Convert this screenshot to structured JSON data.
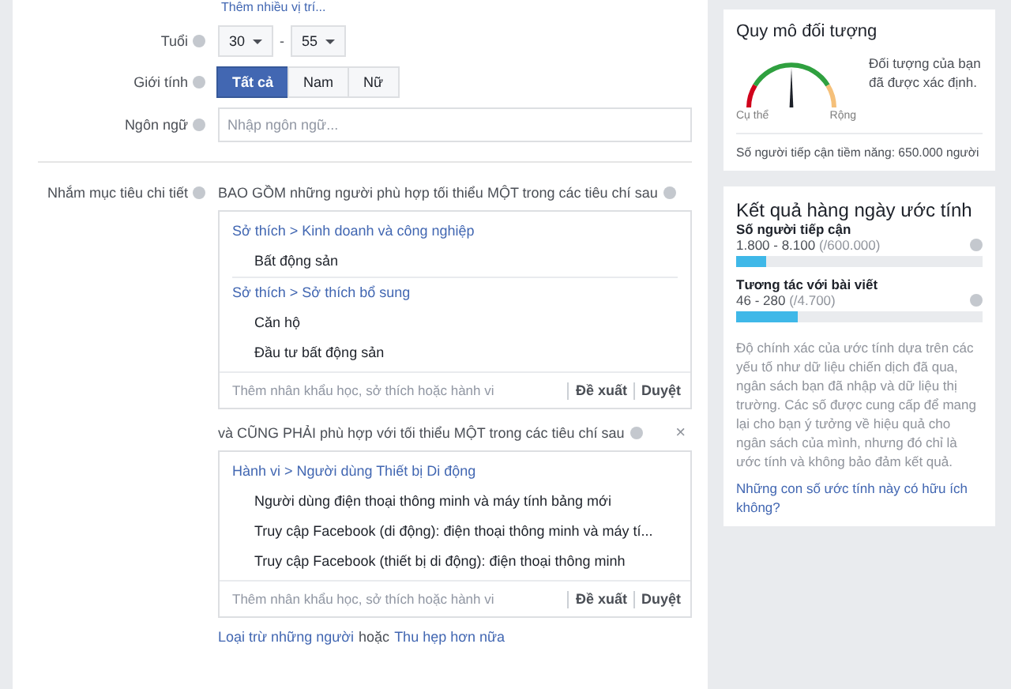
{
  "more_locations_link": "Thêm nhiều vị trí...",
  "age": {
    "label": "Tuổi",
    "from": "30",
    "separator": "-",
    "to": "55"
  },
  "gender": {
    "label": "Giới tính",
    "options": [
      {
        "label": "Tất cả",
        "selected": true
      },
      {
        "label": "Nam",
        "selected": false
      },
      {
        "label": "Nữ",
        "selected": false
      }
    ]
  },
  "language": {
    "label": "Ngôn ngữ",
    "placeholder": "Nhập ngôn ngữ..."
  },
  "detailed_targeting": {
    "label": "Nhắm mục tiêu chi tiết",
    "groups": [
      {
        "heading": "BAO GỒM những người phù hợp tối thiểu MỘT trong các tiêu chí sau",
        "categories": [
          {
            "path": "Sở thích > Kinh doanh và công nghiệp",
            "items": [
              "Bất động sản"
            ]
          },
          {
            "path": "Sở thích > Sở thích bổ sung",
            "items": [
              "Căn hộ",
              "Đầu tư bất động sản"
            ]
          }
        ],
        "placeholder": "Thêm nhân khẩu học, sở thích hoặc hành vi",
        "suggest": "Đề xuất",
        "browse": "Duyệt"
      },
      {
        "heading": "và CŨNG PHẢI phù hợp với tối thiểu MỘT trong các tiêu chí sau",
        "close": "×",
        "categories": [
          {
            "path": "Hành vi > Người dùng Thiết bị Di động",
            "items": [
              "Người dùng điện thoại thông minh và máy tính bảng mới",
              "Truy cập Facebook (di động): điện thoại thông minh và máy tí...",
              "Truy cập Facebook (thiết bị di động): điện thoại thông minh"
            ]
          }
        ],
        "placeholder": "Thêm nhân khẩu học, sở thích hoặc hành vi",
        "suggest": "Đề xuất",
        "browse": "Duyệt"
      }
    ]
  },
  "exclude_link": "Loại trừ những người",
  "or_text": "hoặc",
  "narrow_link": "Thu hẹp hơn nữa",
  "audience_size": {
    "title": "Quy mô đối tượng",
    "specific": "Cụ thể",
    "broad": "Rộng",
    "description": "Đối tượng của bạn đã được xác định.",
    "potential_reach": "Số người tiếp cận tiềm năng: 650.000 người"
  },
  "estimates": {
    "title": "Kết quả hàng ngày ước tính",
    "metrics": [
      {
        "label": "Số người tiếp cận",
        "value": "1.800 - 8.100",
        "total": "(/600.000)",
        "level": 0.12
      },
      {
        "label": "Tương tác với bài viết",
        "value": "46 - 280",
        "total": "(/4.700)",
        "level": 0.25
      }
    ],
    "disclaimer": "Độ chính xác của ước tính dựa trên các yếu tố như dữ liệu chiến dịch đã qua, ngân sách bạn đã nhập và dữ liệu thị trường. Các số được cung cấp để mang lại cho bạn ý tưởng về hiệu quả cho ngân sách của mình, nhưng đó chỉ là ước tính và không bảo đảm kết quả.",
    "feedback_link": "Những con số ước tính này có hữu ích không?"
  }
}
